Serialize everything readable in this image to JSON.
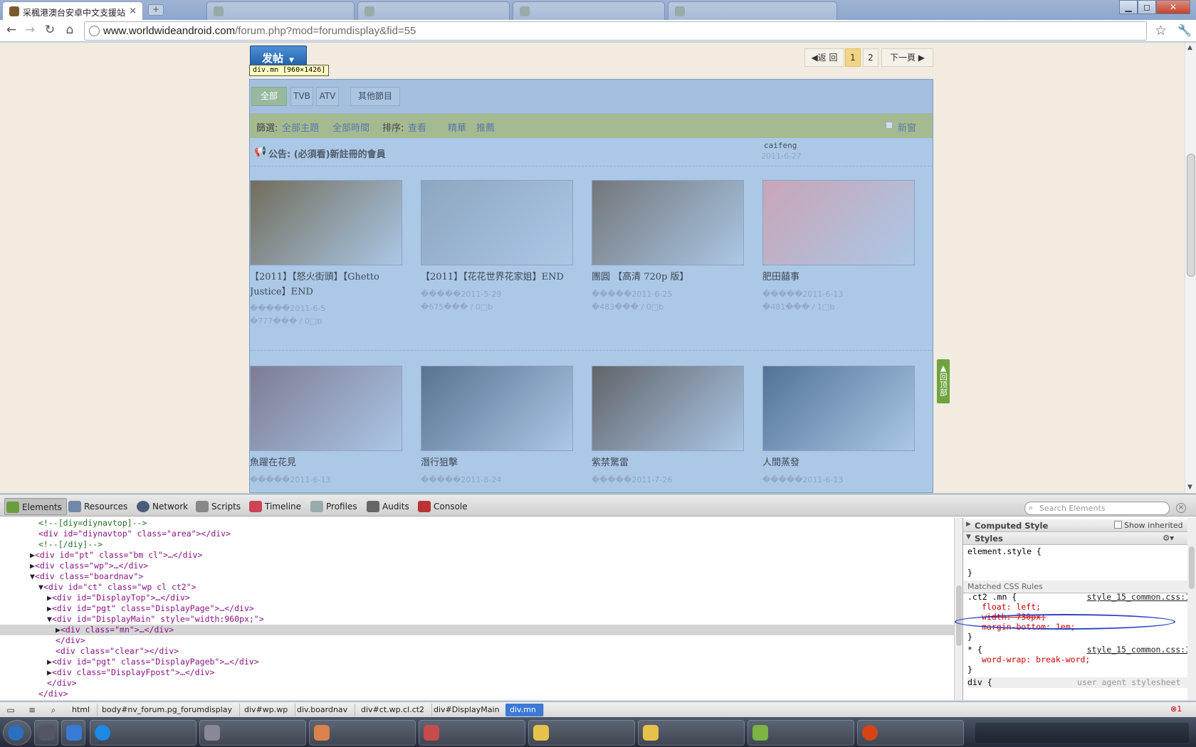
{
  "browser": {
    "tabs": [
      {
        "label": "采楓港澳台安卓中文支援站",
        "active": true
      },
      {
        "label": "",
        "active": false
      },
      {
        "label": "",
        "active": false
      },
      {
        "label": "",
        "active": false
      },
      {
        "label": "",
        "active": false
      }
    ],
    "new_tab_icon": "plus-icon",
    "url_host": "www.worldwideandroid.com",
    "url_rest": "/forum.php?mod=forumdisplay&fid=55",
    "window_controls": [
      "minimize-icon",
      "maximize-icon",
      "close-icon"
    ]
  },
  "page": {
    "post_button": "发帖",
    "element_tooltip": "div.mn [960×1426]",
    "pagination": {
      "prev": "返 回",
      "pages": [
        "1",
        "2"
      ],
      "current": "1",
      "next": "下一頁"
    },
    "type_tabs": [
      {
        "label": "全部",
        "active": true
      },
      {
        "label": "TVB",
        "active": false
      },
      {
        "label": "ATV",
        "active": false
      },
      {
        "label": "其他節目",
        "active": false
      }
    ],
    "filter": {
      "label": "篩選:",
      "all_topics": "全部主題",
      "all_time": "全部時間",
      "sort_label": "排序:",
      "sort_value": "查看",
      "digest": "精華",
      "recommend": "推薦",
      "new_window": "新窗"
    },
    "announcement": {
      "text": "公告: (必須看)新註冊的會員",
      "author": "caifeng",
      "date": "2011-6-27"
    },
    "threads": [
      {
        "title": "【2011】【怒火街頭】【Ghetto Justice】END",
        "meta1": "�����2011-6-5",
        "meta2": "�777��� / 0□b",
        "color": "#6e6a58"
      },
      {
        "title": "【2011】【花花世界花家姐】END",
        "meta1": "�����2011-5-29",
        "meta2": "�675��� / 0□b",
        "color": "#8aa4c0"
      },
      {
        "title": "團圓 【高清 720p 版】",
        "meta1": "�����2011-6-25",
        "meta2": "�483��� / 0□b",
        "color": "#6f7378"
      },
      {
        "title": "肥田囍事",
        "meta1": "�����2011-6-13",
        "meta2": "�481��� / 1□b",
        "color": "#c8a3b6"
      },
      {
        "title": "魚躍在花見",
        "meta1": "�����2011-6-13",
        "meta2": "",
        "color": "#7b7892"
      },
      {
        "title": "潛行狙擊",
        "meta1": "�����2011-8-24",
        "meta2": "",
        "color": "#52708e"
      },
      {
        "title": "紫禁驚雷",
        "meta1": "�����2011-7-26",
        "meta2": "",
        "color": "#5d6066"
      },
      {
        "title": "人間蒸發",
        "meta1": "�����2011-6-13",
        "meta2": "",
        "color": "#4d6f95"
      }
    ],
    "go_top": "回顶部"
  },
  "devtools": {
    "tabs": [
      "Elements",
      "Resources",
      "Network",
      "Scripts",
      "Timeline",
      "Profiles",
      "Audits",
      "Console"
    ],
    "active_tab": "Elements",
    "search_placeholder": "Search Elements",
    "dom_lines": [
      "<!--[diy=diynavtop]-->",
      "<div id=\"diynavtop\" class=\"area\"></div>",
      "<!--[/diy]-->",
      "<div id=\"pt\" class=\"bm cl\">…</div>",
      "<div class=\"wp\">…</div>",
      "<div class=\"boardnav\">",
      "<div id=\"ct\" class=\"wp cl ct2\">",
      "<div id=\"DisplayTop\">…</div>",
      "<div id=\"pgt\" class=\"DisplayPage\">…</div>",
      "<div id=\"DisplayMain\" style=\"width:960px;\">",
      "<div class=\"mn\">…</div>",
      "</div>",
      "<div class=\"clear\"></div>",
      "<div id=\"pgt\" class=\"DisplayPageb\">…</div>",
      "<div class=\"DisplayFpost\">…</div>",
      "</div>",
      "</div>"
    ],
    "sidebar": {
      "computed_style": "Computed Style",
      "show_inherited": "Show inherited",
      "styles": "Styles",
      "element_style": "element.style {",
      "close_brace": "}",
      "matched": "Matched CSS Rules",
      "rule1_selector": ".ct2 .mn {",
      "rule1_source": "style_15_common.css:1",
      "rule1_props": [
        "float: left;",
        "width: 730px;",
        "margin-bottom: 1em;"
      ],
      "rule2_selector": "* {",
      "rule2_source": "style_15_common.css:1",
      "rule2_props": [
        "word-wrap: break-word;"
      ],
      "rule3_selector": "div {",
      "rule3_source": "user agent stylesheet"
    },
    "breadcrumbs": [
      "html",
      "body#nv_forum.pg_forumdisplay",
      "div#wp.wp",
      "div.boardnav",
      "div#ct.wp.cl.ct2",
      "div#DisplayMain",
      "div.mn"
    ],
    "error_count": "1"
  },
  "taskbar": {
    "items": [
      {
        "color": "#2b6fc0"
      },
      {
        "color": "#556"
      },
      {
        "color": "#3a7bd5"
      },
      {
        "color": "#1e88e5"
      },
      {
        "color": "#d9824b"
      },
      {
        "color": "#c84b4b"
      },
      {
        "color": "#e7c24a"
      },
      {
        "color": "#e7c24a"
      },
      {
        "color": "#7cb342"
      },
      {
        "color": "#2e7d32"
      },
      {
        "color": "#d84315"
      }
    ]
  }
}
